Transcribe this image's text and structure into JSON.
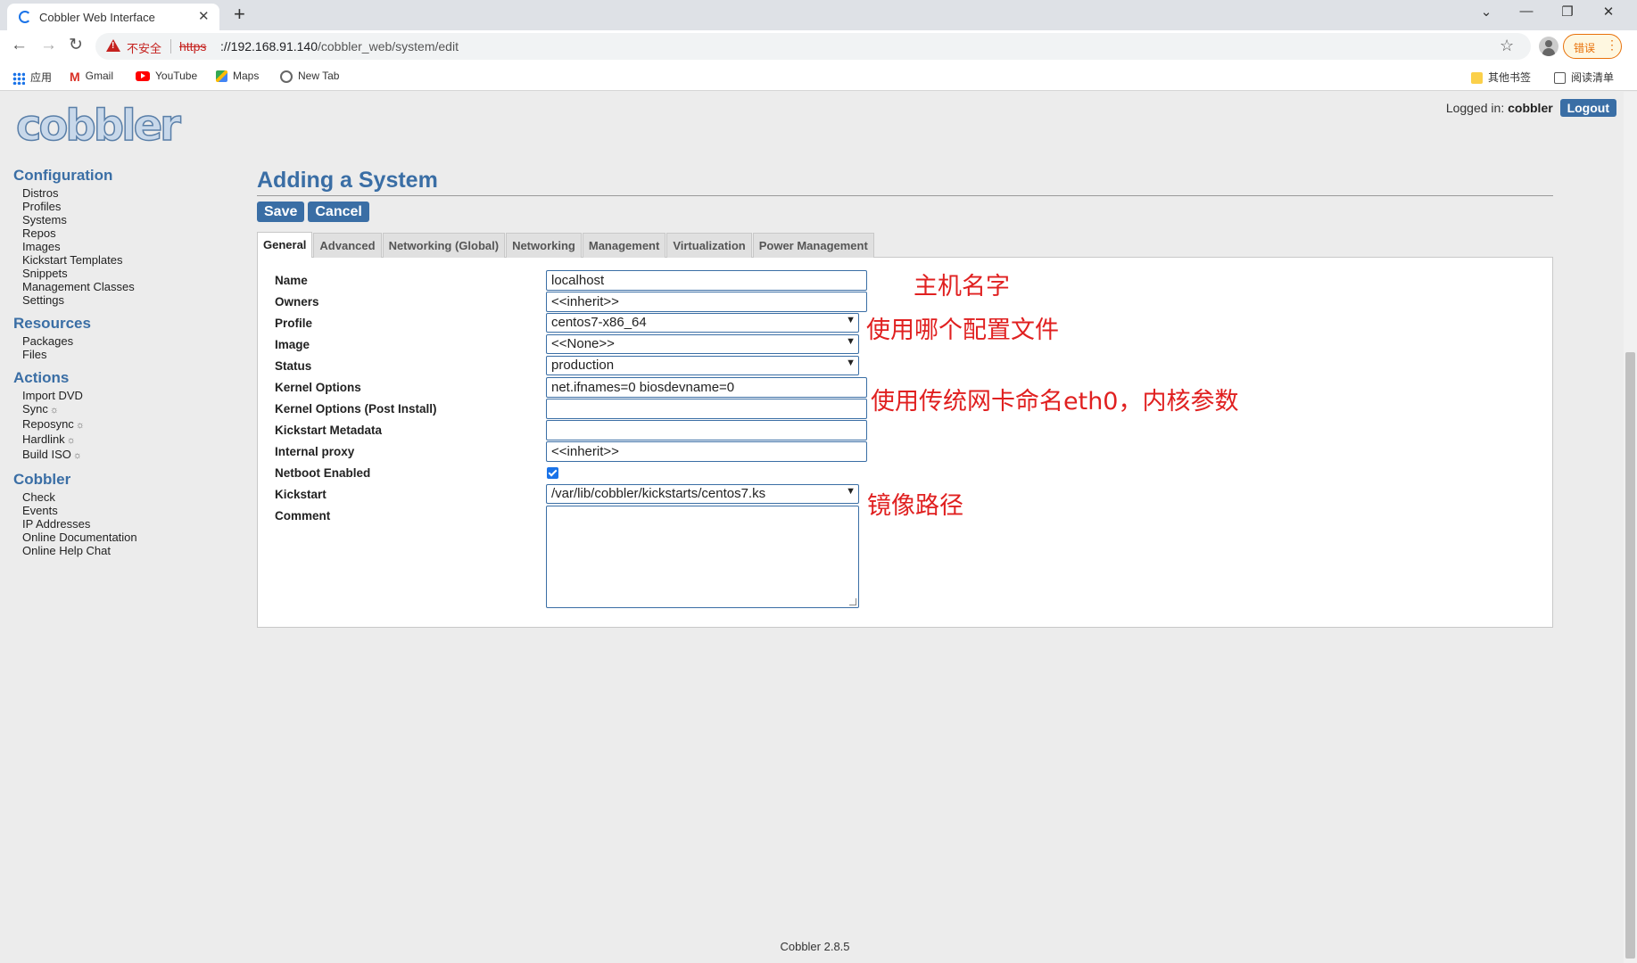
{
  "browser": {
    "tab_title": "Cobbler Web Interface",
    "security_label": "不安全",
    "url_scheme": "https",
    "url_host": "://192.168.91.140",
    "url_path": "/cobbler_web/system/edit",
    "error_label": "错误",
    "bookmarks": {
      "apps": "应用",
      "gmail": "Gmail",
      "youtube": "YouTube",
      "maps": "Maps",
      "new_tab": "New Tab",
      "other": "其他书签",
      "reading_list": "阅读清单"
    }
  },
  "header": {
    "logo_text": "cobbler",
    "logged_in_label": "Logged in:",
    "username": "cobbler",
    "logout_label": "Logout"
  },
  "sidebar": {
    "configuration": {
      "title": "Configuration",
      "items": [
        "Distros",
        "Profiles",
        "Systems",
        "Repos",
        "Images",
        "Kickstart Templates",
        "Snippets",
        "Management Classes",
        "Settings"
      ]
    },
    "resources": {
      "title": "Resources",
      "items": [
        "Packages",
        "Files"
      ]
    },
    "actions": {
      "title": "Actions",
      "items": [
        "Import DVD",
        "Sync",
        "Reposync",
        "Hardlink",
        "Build ISO"
      ]
    },
    "cobbler": {
      "title": "Cobbler",
      "items": [
        "Check",
        "Events",
        "IP Addresses",
        "Online Documentation",
        "Online Help Chat"
      ]
    }
  },
  "main": {
    "title": "Adding a System",
    "save_label": "Save",
    "cancel_label": "Cancel",
    "tabs": [
      "General",
      "Advanced",
      "Networking (Global)",
      "Networking",
      "Management",
      "Virtualization",
      "Power Management"
    ],
    "active_tab": "General",
    "fields": {
      "name": {
        "label": "Name",
        "value": "localhost"
      },
      "owners": {
        "label": "Owners",
        "value": "<<inherit>>"
      },
      "profile": {
        "label": "Profile",
        "value": "centos7-x86_64"
      },
      "image": {
        "label": "Image",
        "value": "<<None>>"
      },
      "status": {
        "label": "Status",
        "value": "production"
      },
      "kernel_options": {
        "label": "Kernel Options",
        "value": "net.ifnames=0 biosdevname=0"
      },
      "kernel_options_post": {
        "label": "Kernel Options (Post Install)",
        "value": ""
      },
      "kickstart_metadata": {
        "label": "Kickstart Metadata",
        "value": ""
      },
      "internal_proxy": {
        "label": "Internal proxy",
        "value": "<<inherit>>"
      },
      "netboot_enabled": {
        "label": "Netboot Enabled",
        "checked": true
      },
      "kickstart": {
        "label": "Kickstart",
        "value": "/var/lib/cobbler/kickstarts/centos7.ks"
      },
      "comment": {
        "label": "Comment",
        "value": ""
      }
    }
  },
  "annotations": {
    "hostname": "主机名字",
    "profile": "使用哪个配置文件",
    "kernel": "使用传统网卡命名eth0，内核参数",
    "kickstart": "镜像路径"
  },
  "footer": {
    "version": "Cobbler 2.8.5"
  },
  "colors": {
    "accent": "#3a6ea5",
    "annotation": "#e02020",
    "insecure": "#c5221f"
  }
}
